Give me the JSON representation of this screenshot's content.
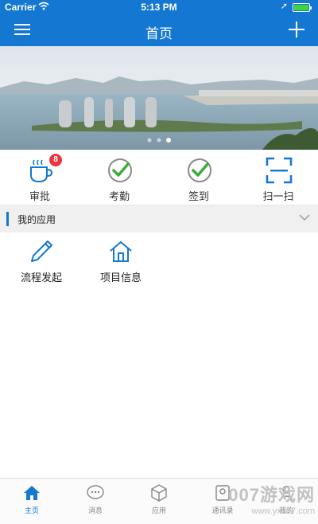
{
  "status_bar": {
    "carrier": "Carrier",
    "time": "5:13 PM"
  },
  "nav": {
    "title": "首页"
  },
  "banner": {
    "slides": 3,
    "active_slide": 3
  },
  "quick_actions": [
    {
      "label": "审批",
      "badge": "8",
      "icon": "coffee-cup-icon"
    },
    {
      "label": "考勤",
      "icon": "check-circle-icon"
    },
    {
      "label": "签到",
      "icon": "check-circle-icon"
    },
    {
      "label": "扫一扫",
      "icon": "scan-icon"
    }
  ],
  "section": {
    "title": "我的应用"
  },
  "apps": [
    {
      "label": "流程发起",
      "icon": "pen-icon"
    },
    {
      "label": "项目信息",
      "icon": "house-icon"
    }
  ],
  "tabbar": [
    {
      "label": "主页",
      "icon": "home-icon",
      "active": true
    },
    {
      "label": "消息",
      "icon": "chat-bubble-icon"
    },
    {
      "label": "应用",
      "icon": "cube-icon"
    },
    {
      "label": "通讯录",
      "icon": "contacts-icon"
    },
    {
      "label": "我的",
      "icon": "person-icon"
    }
  ],
  "watermark": {
    "line1": "007游戏网",
    "line2": "www.yx007.com"
  },
  "colors": {
    "primary": "#1478d2",
    "badge": "#e8383b",
    "check": "#3dab3a"
  }
}
